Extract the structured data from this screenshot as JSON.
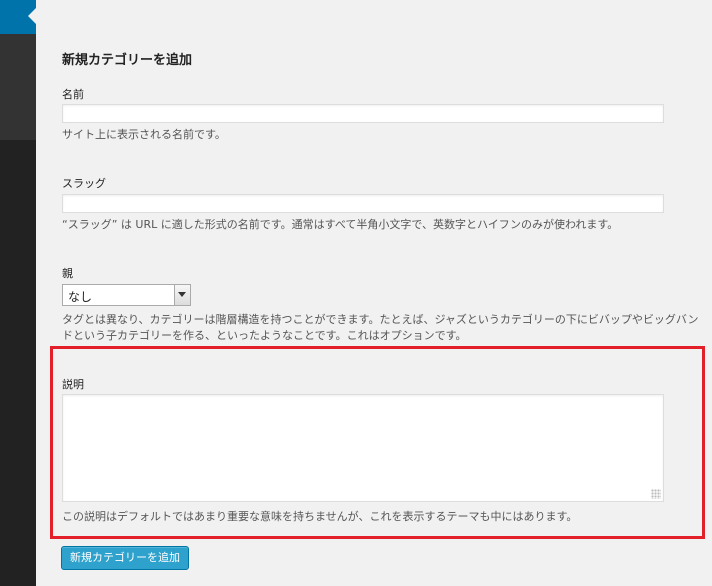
{
  "form": {
    "title": "新規カテゴリーを追加",
    "name": {
      "label": "名前",
      "value": "",
      "help": "サイト上に表示される名前です。"
    },
    "slug": {
      "label": "スラッグ",
      "value": "",
      "help": "“スラッグ” は URL に適した形式の名前です。通常はすべて半角小文字で、英数字とハイフンのみが使われます。"
    },
    "parent": {
      "label": "親",
      "selected": "なし",
      "help": "タグとは異なり、カテゴリーは階層構造を持つことができます。たとえば、ジャズというカテゴリーの下にビバップやビッグバンドという子カテゴリーを作る、といったようなことです。これはオプションです。"
    },
    "description": {
      "label": "説明",
      "value": "",
      "help": "この説明はデフォルトではあまり重要な意味を持ちませんが、これを表示するテーマも中にはあります。"
    },
    "submit_label": "新規カテゴリーを追加"
  },
  "colors": {
    "highlight": "#e3202a",
    "button": "#2ea2cc",
    "sidebar": "#222222",
    "active_menu": "#0073aa"
  }
}
